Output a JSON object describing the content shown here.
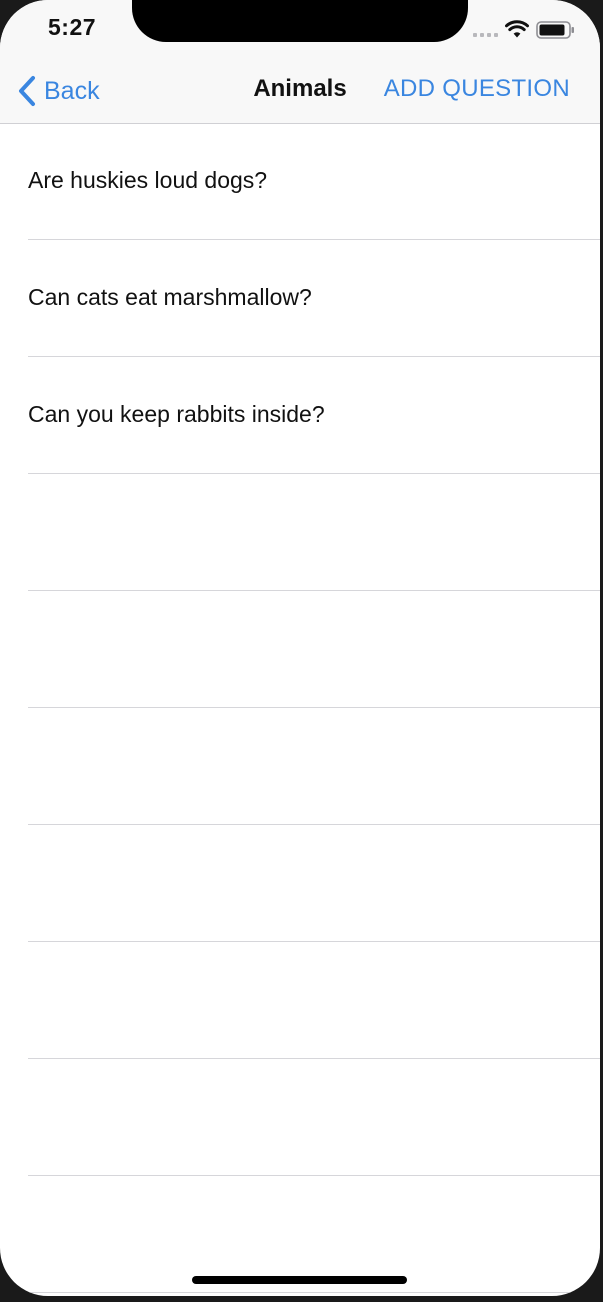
{
  "status_bar": {
    "time": "5:27",
    "icons": [
      "cellular-signal-icon",
      "wifi-icon",
      "battery-icon"
    ]
  },
  "nav_bar": {
    "back_label": "Back",
    "back_icon": "chevron-left-icon",
    "title": "Animals",
    "add_label": "ADD QUESTION"
  },
  "questions": [
    {
      "text": "Are huskies loud dogs?"
    },
    {
      "text": "Can cats eat marshmallow?"
    },
    {
      "text": "Can you keep rabbits inside?"
    },
    {
      "text": ""
    },
    {
      "text": ""
    },
    {
      "text": ""
    },
    {
      "text": ""
    },
    {
      "text": ""
    },
    {
      "text": ""
    },
    {
      "text": ""
    }
  ],
  "colors": {
    "accent": "#3a86e0",
    "nav_background": "#f8f8f8",
    "separator": "#d6d6da",
    "text": "#111111"
  }
}
